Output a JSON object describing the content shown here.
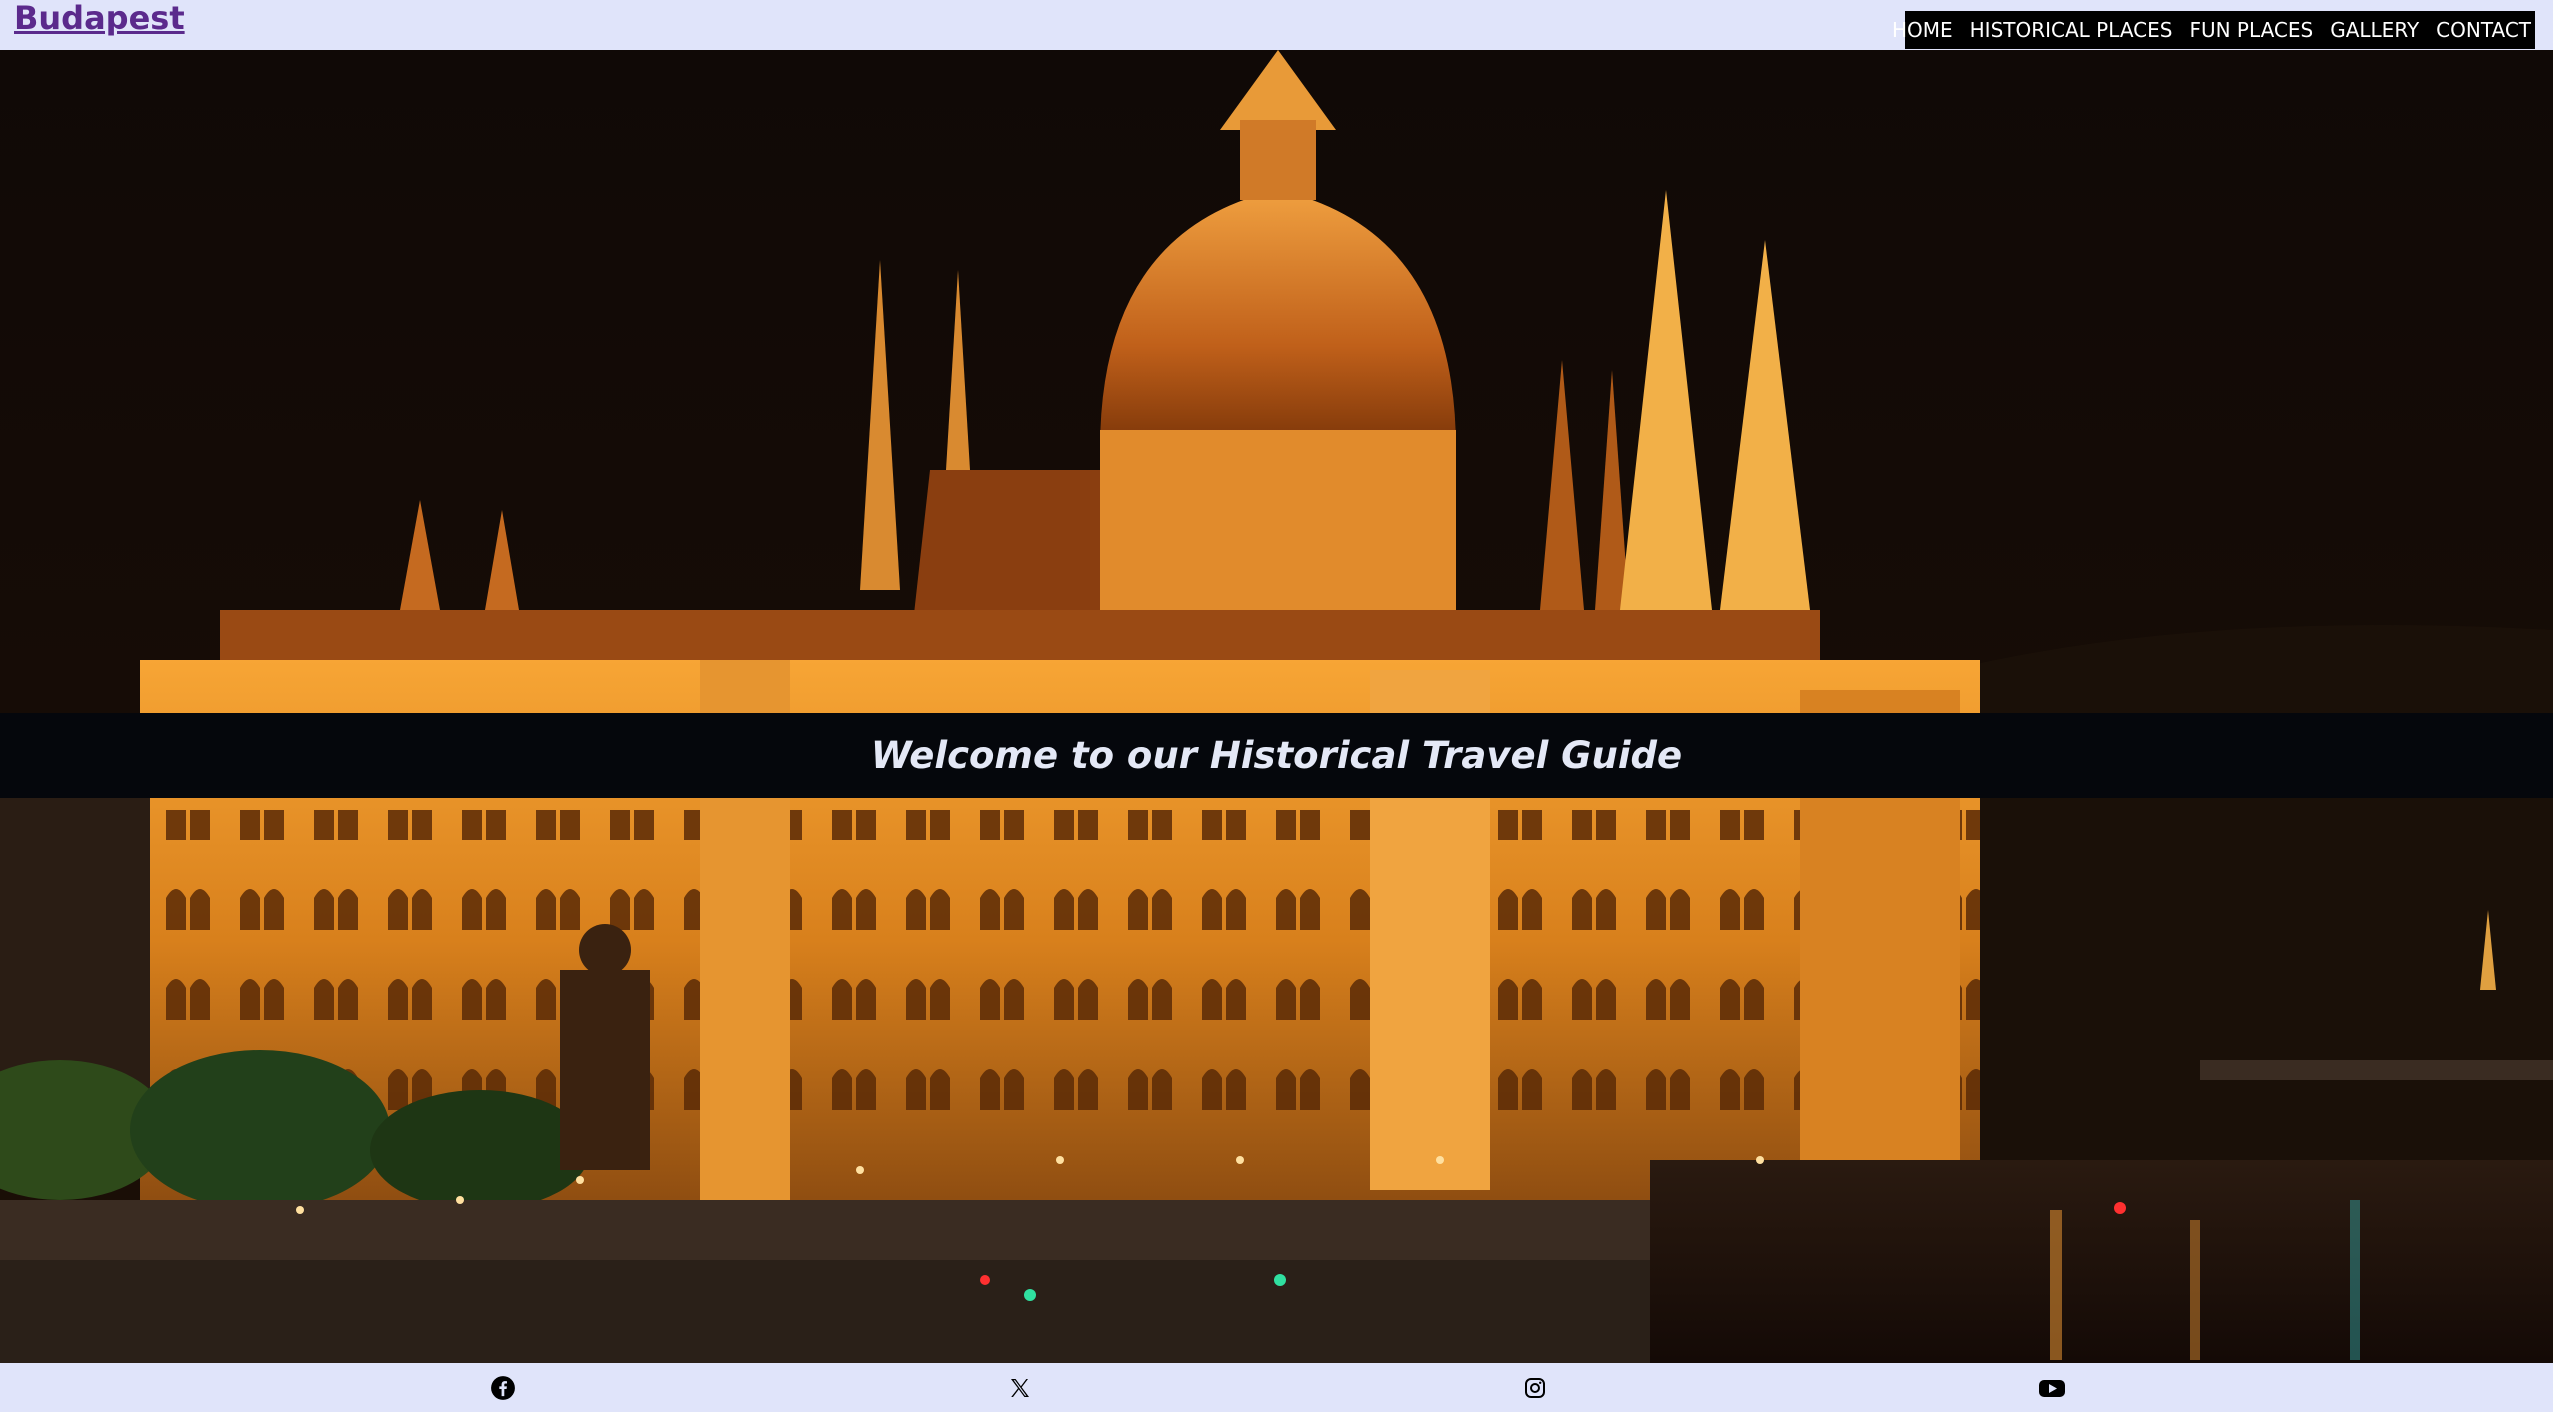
{
  "header": {
    "logo": "Budapest",
    "nav": [
      "HOME",
      "HISTORICAL PLACES",
      "FUN PLACES",
      "GALLERY",
      "CONTACT"
    ]
  },
  "hero": {
    "image_alt": "Hungarian Parliament Building illuminated at night beside the Danube",
    "banner_text": "Welcome to our Historical Travel Guide"
  },
  "footer": {
    "social_icons": [
      "facebook-icon",
      "x-icon",
      "instagram-icon",
      "youtube-icon"
    ]
  },
  "colors": {
    "header_bg": "#e0e4fa",
    "logo": "#5b2a8c",
    "nav_bg": "#000000",
    "banner_bg": "#05070c",
    "banner_text": "#e4e8f6"
  }
}
